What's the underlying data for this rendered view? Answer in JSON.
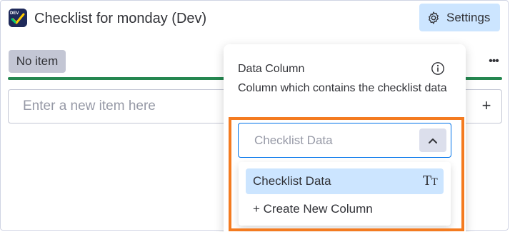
{
  "app": {
    "title": "Checklist for monday (Dev)",
    "logo_badge": "DEV",
    "logo_icon": "checklist-check-icon"
  },
  "header": {
    "settings_label": "Settings",
    "settings_icon": "gear-icon"
  },
  "checklist": {
    "status_chip": "No item",
    "more_label": "•••",
    "progress_color": "#258750",
    "new_item_placeholder": "Enter a new item here",
    "add_label": "+"
  },
  "settings_popover": {
    "field_label": "Data Column",
    "field_description": "Column which contains the checklist data",
    "select_placeholder": "Checklist Data",
    "options": [
      {
        "label": "Checklist Data",
        "type_icon": "text-type-icon",
        "selected": true
      },
      {
        "label": "+ Create New Column",
        "selected": false
      }
    ]
  },
  "colors": {
    "accent": "#0073ea",
    "selected_bg": "#cce5ff",
    "highlight": "#f47b20"
  }
}
